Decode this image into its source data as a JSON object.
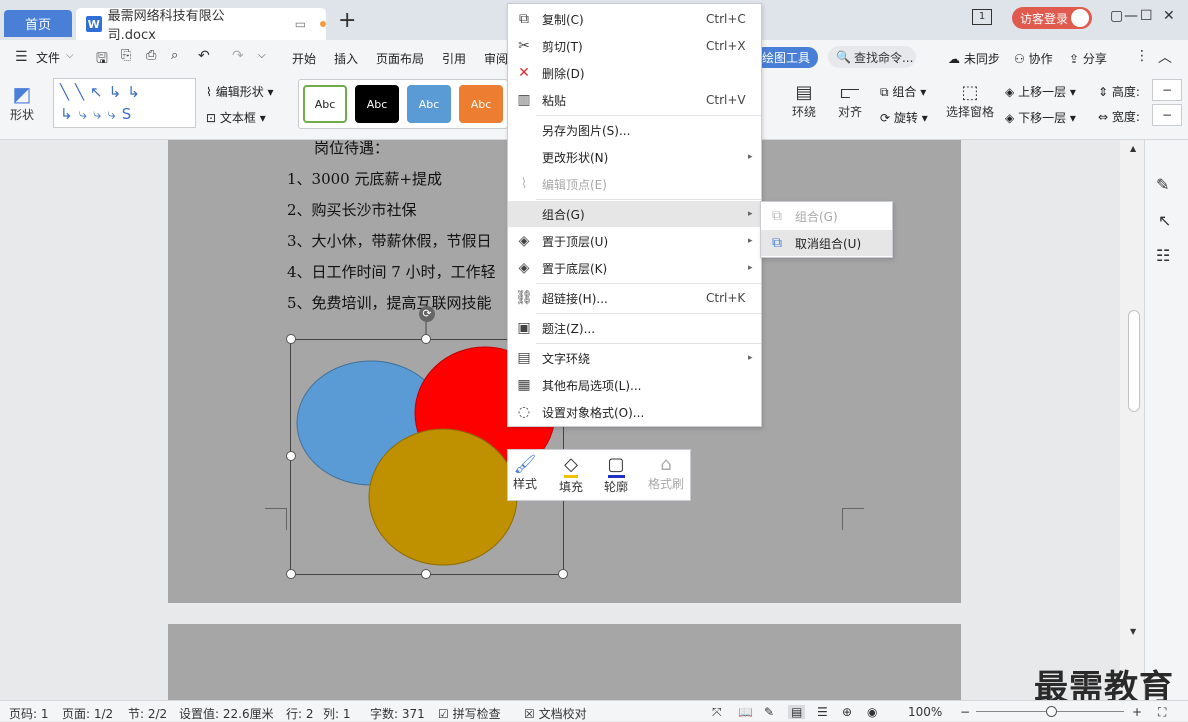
{
  "tabs": {
    "home": "首页",
    "doc_title": "最需网络科技有限公司.docx",
    "login": "访客登录"
  },
  "menu": {
    "file": "文件",
    "items": [
      "开始",
      "插入",
      "页面布局",
      "引用",
      "审阅"
    ],
    "drawing_tools": "绘图工具",
    "search": "查找命令...",
    "unsynced": "未同步",
    "collab": "协作",
    "share": "分享"
  },
  "ribbon": {
    "shape": "形状",
    "edit_shape": "编辑形状",
    "textbox": "文本框",
    "abc": "Abc",
    "wrap": "环绕",
    "align": "对齐",
    "group": "组合",
    "rotate": "旋转",
    "select_pane": "选择窗格",
    "bring_forward": "上移一层",
    "send_backward": "下移一层",
    "height": "高度:",
    "width": "宽度:"
  },
  "document": {
    "heading": "岗位待遇：",
    "lines": [
      "1、3000 元底薪+提成",
      "2、购买长沙市社保",
      "3、大小休，带薪休假，节假日",
      "4、日工作时间 7 小时，工作轻",
      "5、免费培训，提高互联网技能"
    ]
  },
  "context_menu": [
    {
      "icon": "copy-icon",
      "glyph": "⧉",
      "label": "复制(C)",
      "shortcut": "Ctrl+C"
    },
    {
      "icon": "scissors-icon",
      "glyph": "✂",
      "label": "剪切(T)",
      "shortcut": "Ctrl+X"
    },
    {
      "icon": "delete-icon",
      "glyph": "✕",
      "label": "删除(D)",
      "shortcut": ""
    },
    {
      "icon": "paste-icon",
      "glyph": "📋",
      "label": "粘贴",
      "shortcut": "Ctrl+V"
    },
    {
      "icon": "save-image-icon",
      "glyph": "",
      "label": "另存为图片(S)...",
      "shortcut": ""
    },
    {
      "icon": "change-shape-icon",
      "glyph": "",
      "label": "更改形状(N)",
      "shortcut": ""
    },
    {
      "icon": "edit-points-icon",
      "glyph": "⌇",
      "label": "编辑顶点(E)",
      "shortcut": ""
    },
    {
      "icon": "group-icon",
      "glyph": "",
      "label": "组合(G)",
      "shortcut": ""
    },
    {
      "icon": "bring-to-front-icon",
      "glyph": "◈",
      "label": "置于顶层(U)",
      "shortcut": ""
    },
    {
      "icon": "send-to-back-icon",
      "glyph": "◈",
      "label": "置于底层(K)",
      "shortcut": ""
    },
    {
      "icon": "link-icon",
      "glyph": "⛓",
      "label": "超链接(H)...",
      "shortcut": "Ctrl+K"
    },
    {
      "icon": "caption-icon",
      "glyph": "▣",
      "label": "题注(Z)...",
      "shortcut": ""
    },
    {
      "icon": "text-wrap-icon",
      "glyph": "▤",
      "label": "文字环绕",
      "shortcut": ""
    },
    {
      "icon": "layout-options-icon",
      "glyph": "▦",
      "label": "其他布局选项(L)...",
      "shortcut": ""
    },
    {
      "icon": "format-object-icon",
      "glyph": "◌",
      "label": "设置对象格式(O)...",
      "shortcut": ""
    }
  ],
  "submenu": [
    {
      "label": "组合(G)"
    },
    {
      "label": "取消组合(U)"
    }
  ],
  "mini_toolbar": [
    "样式",
    "填充",
    "轮廓",
    "格式刷"
  ],
  "status": {
    "page": "页码: 1",
    "pages": "页面: 1/2",
    "section": "节: 2/2",
    "setting": "设置值: 22.6厘米",
    "row": "行: 2",
    "col": "列: 1",
    "words": "字数: 371",
    "spell": "拼写检查",
    "proof": "文档校对",
    "zoom": "100%"
  },
  "watermark": "最需教育",
  "colors": {
    "accent": "#4a7fd8",
    "ellipse_blue": "#5b9bd5",
    "ellipse_red": "#ff0000",
    "ellipse_gold": "#bf9000"
  }
}
